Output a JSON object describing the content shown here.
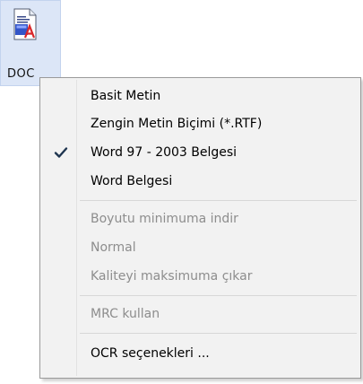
{
  "format_button": {
    "label": "DOC",
    "icon": "word-document-icon"
  },
  "context_menu": {
    "check_icon": "checkmark-icon",
    "items": [
      {
        "label": "Basit Metin",
        "enabled": true,
        "checked": false
      },
      {
        "label": "Zengin Metin Biçimi (*.RTF)",
        "enabled": true,
        "checked": false
      },
      {
        "label": "Word 97 - 2003 Belgesi",
        "enabled": true,
        "checked": true
      },
      {
        "label": "Word Belgesi",
        "enabled": true,
        "checked": false
      },
      {
        "label": "Boyutu minimuma indir",
        "enabled": false,
        "checked": false
      },
      {
        "label": "Normal",
        "enabled": false,
        "checked": false
      },
      {
        "label": "Kaliteyi maksimuma çıkar",
        "enabled": false,
        "checked": false
      },
      {
        "label": "MRC kullan",
        "enabled": false,
        "checked": false
      },
      {
        "label": "OCR seçenekleri ...",
        "enabled": true,
        "checked": false
      }
    ]
  },
  "colors": {
    "button_background": "#dce6f7",
    "menu_background": "#f2f2f2",
    "disabled_text": "#8d8d8d"
  }
}
